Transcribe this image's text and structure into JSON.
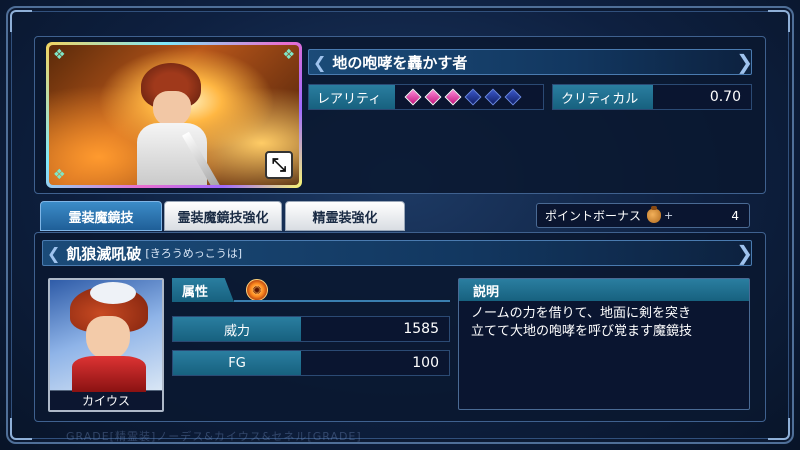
{
  "skill_name_header": "地の咆哮を轟かす者",
  "rarity": {
    "label": "レアリティ",
    "filled": 3,
    "total": 6
  },
  "critical": {
    "label": "クリティカル",
    "value": "0.70"
  },
  "tabs": [
    {
      "label": "霊装魔鏡技",
      "active": true
    },
    {
      "label": "霊装魔鏡技強化",
      "active": false
    },
    {
      "label": "精霊装強化",
      "active": false
    }
  ],
  "bonus": {
    "label": "ポイントボーナス",
    "plus": "+",
    "value": "4",
    "icon": "bag-icon"
  },
  "technique": {
    "name": "飢狼滅吼破",
    "reading": "[きろうめっこうは]"
  },
  "character": {
    "name": "カイウス"
  },
  "attribute": {
    "label": "属性",
    "icon": "fire-element-icon"
  },
  "stats": [
    {
      "label": "威力",
      "value": "1585"
    },
    {
      "label": "FG",
      "value": "100"
    }
  ],
  "description": {
    "header": "説明",
    "lines": [
      "ノームの力を借りて、地面に剣を突き",
      "立てて大地の咆哮を呼び覚ます魔鏡技"
    ]
  },
  "footer": "GRADE[精霊装]ノーデス&カイウス&セネル[GRADE]",
  "colors": {
    "accent": "#2a7ea0",
    "gem_on": "#e040a0",
    "gem_off": "#3a57c8"
  }
}
